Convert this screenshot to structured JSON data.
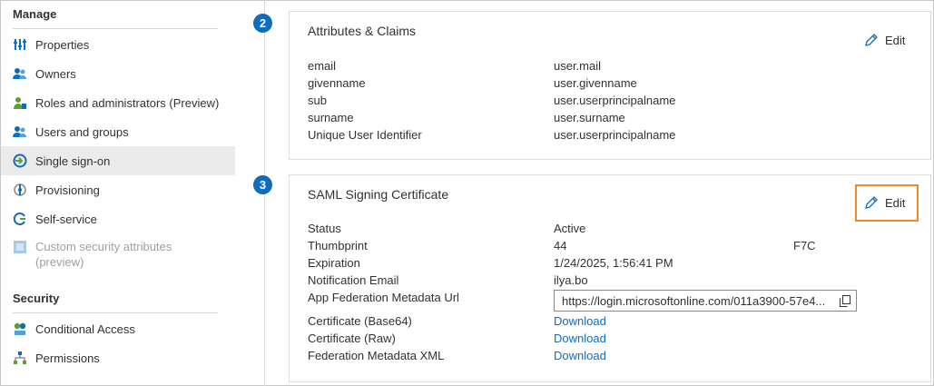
{
  "sidebar": {
    "manage_header": "Manage",
    "manage_items": [
      {
        "label": "Properties",
        "icon": "properties-icon"
      },
      {
        "label": "Owners",
        "icon": "owners-icon"
      },
      {
        "label": "Roles and administrators (Preview)",
        "icon": "roles-icon"
      },
      {
        "label": "Users and groups",
        "icon": "users-groups-icon"
      },
      {
        "label": "Single sign-on",
        "icon": "single-sign-on-icon",
        "active": true
      },
      {
        "label": "Provisioning",
        "icon": "provisioning-icon"
      },
      {
        "label": "Self-service",
        "icon": "self-service-icon"
      },
      {
        "label": "Custom security attributes",
        "label2": "(preview)",
        "icon": "custom-security-icon",
        "disabled": true
      }
    ],
    "security_header": "Security",
    "security_items": [
      {
        "label": "Conditional Access",
        "icon": "conditional-access-icon"
      },
      {
        "label": "Permissions",
        "icon": "permissions-icon"
      }
    ]
  },
  "steps": {
    "attributes": "2",
    "saml": "3"
  },
  "attributes_card": {
    "title": "Attributes & Claims",
    "edit_label": "Edit",
    "rows": [
      {
        "name": "email",
        "value": "user.mail"
      },
      {
        "name": "givenname",
        "value": "user.givenname"
      },
      {
        "name": "sub",
        "value": "user.userprincipalname"
      },
      {
        "name": "surname",
        "value": "user.surname"
      },
      {
        "name": "Unique User Identifier",
        "value": "user.userprincipalname"
      }
    ]
  },
  "saml_card": {
    "title": "SAML Signing Certificate",
    "edit_label": "Edit",
    "status_label": "Status",
    "status_value": "Active",
    "thumbprint_label": "Thumbprint",
    "thumbprint_value": "44",
    "thumbprint_value2": "F7C",
    "expiration_label": "Expiration",
    "expiration_value": "1/24/2025, 1:56:41 PM",
    "notification_label": "Notification Email",
    "notification_value": "ilya.bo",
    "metadata_url_label": "App Federation Metadata Url",
    "metadata_url_value": "https://login.microsoftonline.com/011a3900-57e4...",
    "cert_base64_label": "Certificate (Base64)",
    "cert_raw_label": "Certificate (Raw)",
    "fed_xml_label": "Federation Metadata XML",
    "download_label": "Download"
  },
  "colors": {
    "accent": "#0f6cbd",
    "highlight": "#f0892c",
    "active_bg": "#ebebeb"
  }
}
